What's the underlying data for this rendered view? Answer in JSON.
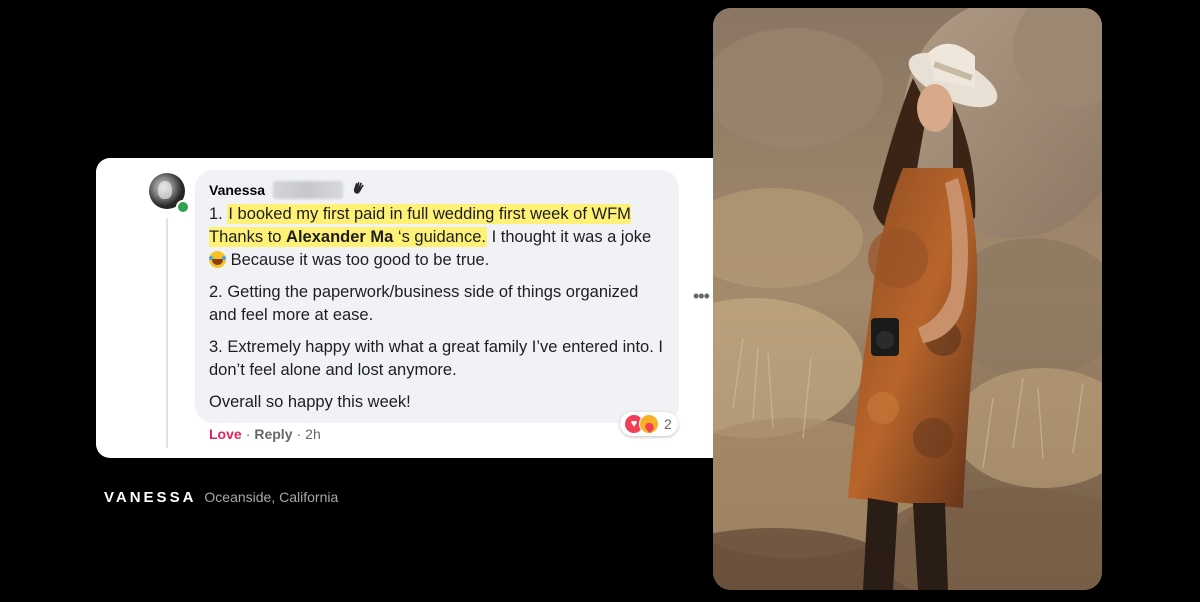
{
  "comment": {
    "author": "Vanessa",
    "paragraphs": {
      "p1": {
        "num": "1. ",
        "hl_a": "I booked my first paid in full wedding first week of WFM Thanks to ",
        "hl_bold": "Alexander Ma",
        "hl_b": " ‘s guidance.",
        "rest_a": " I thought it was a joke ",
        "rest_b": " Because it was too good to be true."
      },
      "p2": "2. Getting the paperwork/business side of things organized and feel more at ease.",
      "p3": "3. Extremely happy with what a great family I’ve entered into. I don’t feel alone and lost anymore.",
      "p4": "Overall so happy this week!"
    },
    "reaction_count": "2",
    "actions": {
      "love": "Love",
      "reply": "Reply",
      "time": "2h",
      "sep": "·"
    },
    "more_label": "•••",
    "emoji": "laughing-with-tears-icon",
    "badge": "waving-hand-icon"
  },
  "caption": {
    "name": "VANESSA",
    "location": "Oceanside, California"
  },
  "colors": {
    "background": "#000000",
    "highlight": "#fff176",
    "love": "#e0245e",
    "bubble": "#f0f2f5"
  }
}
